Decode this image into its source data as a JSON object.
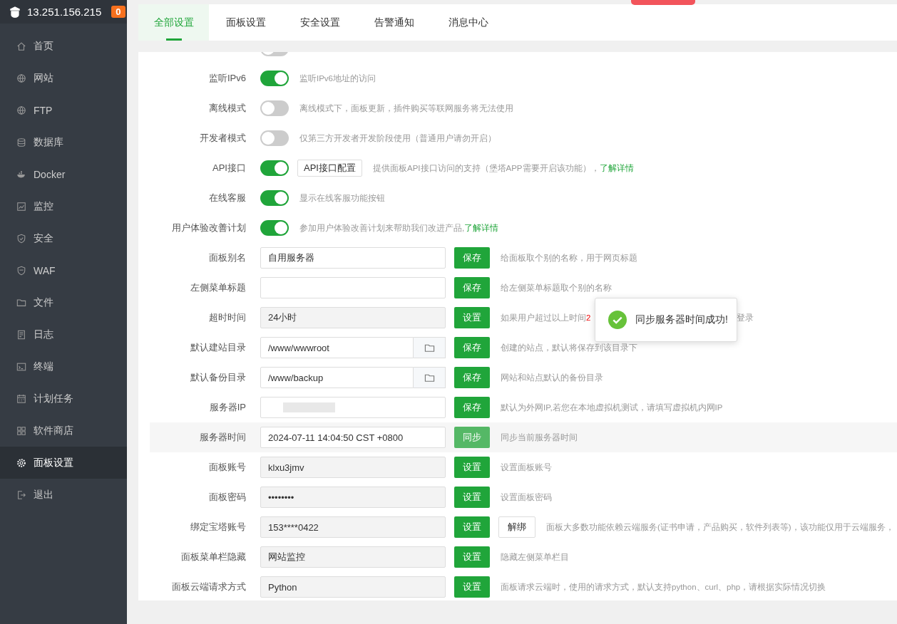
{
  "sidebar": {
    "host": "13.251.156.215",
    "badge": "0",
    "items": [
      {
        "label": "首页",
        "selected": false
      },
      {
        "label": "网站",
        "selected": false
      },
      {
        "label": "FTP",
        "selected": false
      },
      {
        "label": "数据库",
        "selected": false
      },
      {
        "label": "Docker",
        "selected": false
      },
      {
        "label": "监控",
        "selected": false
      },
      {
        "label": "安全",
        "selected": false
      },
      {
        "label": "WAF",
        "selected": false
      },
      {
        "label": "文件",
        "selected": false
      },
      {
        "label": "日志",
        "selected": false
      },
      {
        "label": "终端",
        "selected": false
      },
      {
        "label": "计划任务",
        "selected": false
      },
      {
        "label": "软件商店",
        "selected": false
      },
      {
        "label": "面板设置",
        "selected": true
      },
      {
        "label": "退出",
        "selected": false
      }
    ]
  },
  "tabs": [
    {
      "label": "全部设置",
      "selected": true
    },
    {
      "label": "面板设置",
      "selected": false
    },
    {
      "label": "安全设置",
      "selected": false
    },
    {
      "label": "告警通知",
      "selected": false
    },
    {
      "label": "消息中心",
      "selected": false
    }
  ],
  "settings": [
    {
      "kind": "toggle",
      "on": false
    },
    {
      "kind": "toggle",
      "label": "监听IPv6",
      "on": true,
      "description": "监听IPv6地址的访问"
    },
    {
      "kind": "toggle",
      "label": "离线模式",
      "on": false,
      "description": "离线模式下，面板更新，插件购买等联网服务将无法使用"
    },
    {
      "kind": "toggle",
      "label": "开发者模式",
      "on": false,
      "description": "仅第三方开发者开发阶段使用（普通用户请勿开启）"
    },
    {
      "kind": "toggle",
      "label": "API接口",
      "on": true,
      "button": "API接口配置",
      "description": "提供面板API接口访问的支持（堡塔APP需要开启该功能），",
      "link": "了解详情"
    },
    {
      "kind": "toggle",
      "label": "在线客服",
      "on": true,
      "description": "显示在线客服功能按钮"
    },
    {
      "kind": "toggle",
      "label": "用户体验改善计划",
      "on": true,
      "description": "参加用户体验改善计划来帮助我们改进产品,",
      "link": "了解详情"
    },
    {
      "kind": "field",
      "label": "面板别名",
      "value": "自用服务器",
      "readonly": false,
      "button": "保存",
      "description": "给面板取个别的名称，用于网页标题"
    },
    {
      "kind": "field",
      "label": "左侧菜单标题",
      "readonly": false,
      "button": "保存",
      "description": "给左侧菜单标题取个别的名称"
    },
    {
      "kind": "field",
      "label": "超时时间",
      "value": "24小时",
      "readonly": true,
      "button": "设置",
      "description": "如果用户超过以上时间",
      "description_highlight": "2",
      "description_tail": "登录"
    },
    {
      "kind": "field",
      "label": "默认建站目录",
      "value": "/www/wwwroot",
      "readonly": false,
      "folder": true,
      "button": "保存",
      "description": "创建的站点，默认将保存到该目录下"
    },
    {
      "kind": "field",
      "label": "默认备份目录",
      "value": "/www/backup",
      "readonly": false,
      "folder": true,
      "button": "保存",
      "description": "网站和站点默认的备份目录"
    },
    {
      "kind": "field",
      "label": "服务器IP",
      "redacted": true,
      "readonly": false,
      "button": "保存",
      "description": "默认为外网IP,若您在本地虚拟机测试，请填写虚拟机内网IP"
    },
    {
      "kind": "field",
      "label": "服务器时间",
      "value": "2024-07-11 14:04:50 CST +0800",
      "readonly": false,
      "highlighted": true,
      "button": "同步",
      "description": "同步当前服务器时间"
    },
    {
      "kind": "field",
      "label": "面板账号",
      "value": "klxu3jmv",
      "readonly": true,
      "button": "设置",
      "description": "设置面板账号"
    },
    {
      "kind": "field",
      "label": "面板密码",
      "value": "••••••••",
      "readonly": true,
      "button": "设置",
      "description": "设置面板密码"
    },
    {
      "kind": "field",
      "label": "绑定宝塔账号",
      "value": "153****0422",
      "readonly": true,
      "button": "设置",
      "secondary_button": "解绑",
      "description": "面板大多数功能依赖云端服务(证书申请，产品购买，软件列表等)，该功能仅用于云端服务，"
    },
    {
      "kind": "field",
      "label": "面板菜单栏隐藏",
      "value": "网站监控",
      "readonly": true,
      "button": "设置",
      "description": "隐藏左侧菜单栏目"
    },
    {
      "kind": "field",
      "label": "面板云端请求方式",
      "value": "Python",
      "readonly": true,
      "button": "设置",
      "description": "面板请求云端时，使用的请求方式，默认支持python、curl、php，请根据实际情况切换"
    }
  ],
  "toast": {
    "message": "同步服务器时间成功!"
  }
}
